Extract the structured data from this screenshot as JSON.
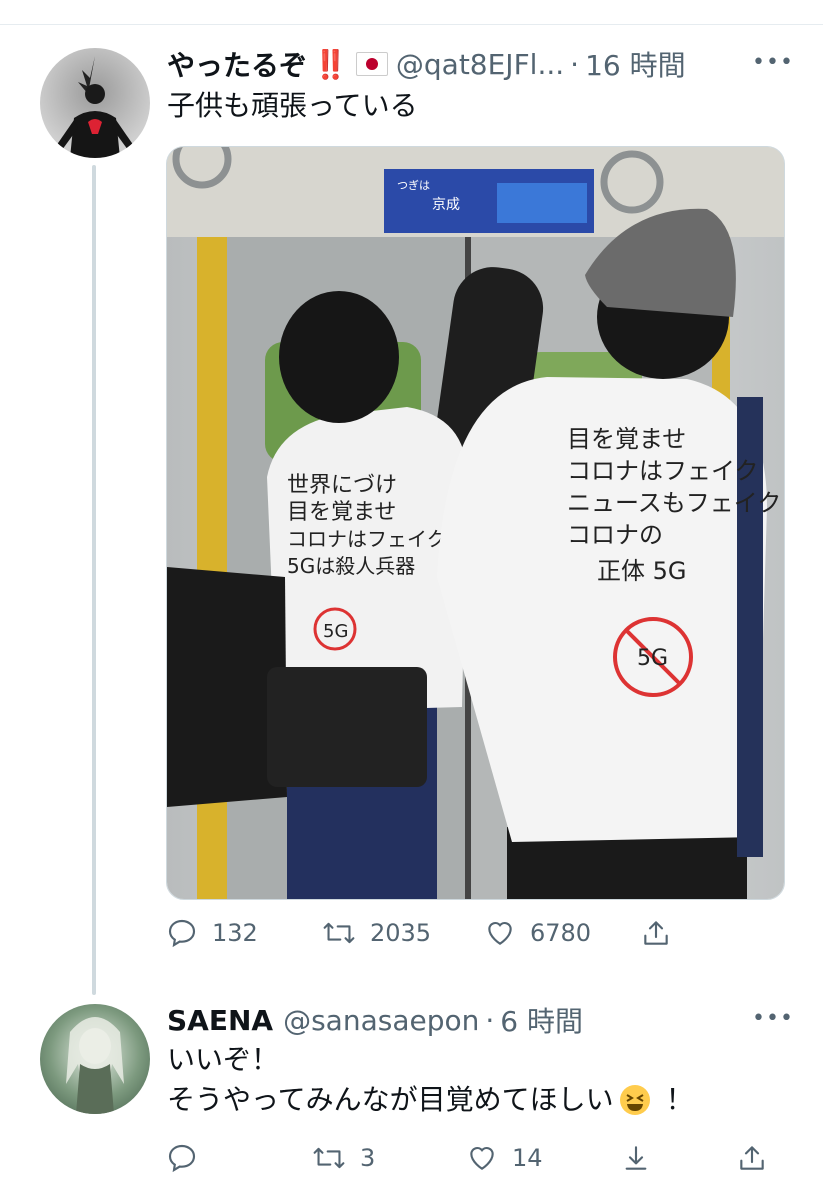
{
  "tweet1": {
    "display_name": "やったるぞ",
    "name_emoji": "‼️",
    "flag_icon": "japan-flag-icon",
    "handle": "@qat8EJFl...",
    "dot": "·",
    "time": "16 時間",
    "text": "子供も頑張っている",
    "replies": "132",
    "retweets": "2035",
    "likes": "6780",
    "more_icon": "more-dots-icon",
    "photo_text": {
      "sign_line1": "つぎは",
      "sign_line2": "京成",
      "left_shirt": [
        "世界にづけ",
        "目を覚ませ",
        "コロナはフェイク",
        "5Gは殺人兵器"
      ],
      "left_badge": "5G",
      "right_shirt": [
        "目を覚ませ",
        "コロナはフェイク",
        "ニュースもフェイク",
        "コロナの",
        "正体 5G"
      ],
      "right_badge": "5G"
    }
  },
  "tweet2": {
    "display_name": "SAENA",
    "handle": "@sanasaepon",
    "dot": "·",
    "time": "6 時間",
    "text_line1": "いいぞ！",
    "text_line2": "そうやってみんなが目覚めてほしい",
    "text_end": "！",
    "replies": "",
    "retweets": "3",
    "likes": "14",
    "more_icon": "more-dots-icon"
  },
  "colors": {
    "name": "#0f1419",
    "secondary": "#536471",
    "thread_line": "#cfd9de"
  }
}
